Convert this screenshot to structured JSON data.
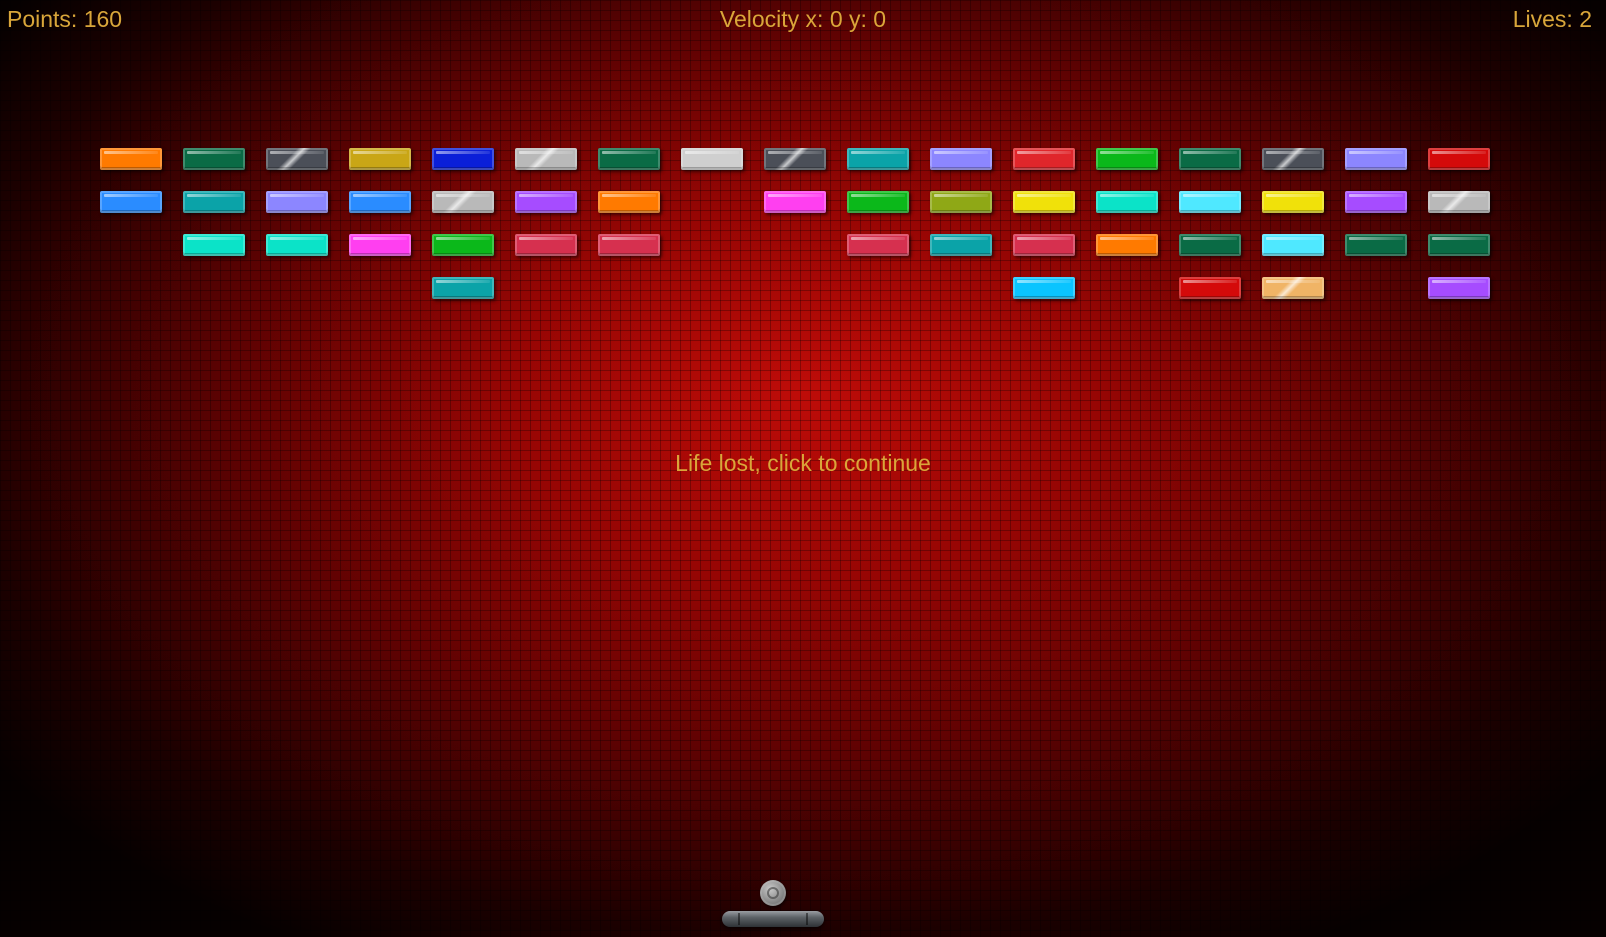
{
  "hud": {
    "points": "Points: 160",
    "velocity": "Velocity x: 0 y: 0",
    "lives": "Lives: 2"
  },
  "message": "Life lost, click to continue",
  "colors": {
    "hud_text": "#d9a63a"
  },
  "bricks": [
    [
      {
        "col": 0,
        "color": "#ff7a00"
      },
      {
        "col": 1,
        "color": "#0a6b45"
      },
      {
        "col": 2,
        "color": "#4b4f58",
        "shiny": true
      },
      {
        "col": 3,
        "color": "#c9a616"
      },
      {
        "col": 4,
        "color": "#0b1fd8"
      },
      {
        "col": 5,
        "color": "#b9b9b9",
        "shiny": true
      },
      {
        "col": 6,
        "color": "#0a6b45"
      },
      {
        "col": 7,
        "color": "#cfcfcf"
      },
      {
        "col": 8,
        "color": "#4b4f58",
        "shiny": true
      },
      {
        "col": 9,
        "color": "#0ba3a8"
      },
      {
        "col": 10,
        "color": "#8c86ff"
      },
      {
        "col": 11,
        "color": "#e0262b"
      },
      {
        "col": 12,
        "color": "#0bb81a"
      },
      {
        "col": 13,
        "color": "#0a6b45"
      },
      {
        "col": 14,
        "color": "#4b4f58",
        "shiny": true
      },
      {
        "col": 15,
        "color": "#8c86ff"
      },
      {
        "col": 16,
        "color": "#d40a0a"
      }
    ],
    [
      {
        "col": 0,
        "color": "#2a8cff"
      },
      {
        "col": 1,
        "color": "#0ba3a8"
      },
      {
        "col": 2,
        "color": "#8c86ff"
      },
      {
        "col": 3,
        "color": "#2a8cff"
      },
      {
        "col": 4,
        "color": "#b9b9b9",
        "shiny": true
      },
      {
        "col": 5,
        "color": "#a64cff"
      },
      {
        "col": 6,
        "color": "#ff7a00"
      },
      {
        "col": 8,
        "color": "#ff3ff0"
      },
      {
        "col": 9,
        "color": "#0bb81a"
      },
      {
        "col": 10,
        "color": "#8fa816"
      },
      {
        "col": 11,
        "color": "#f0e10a"
      },
      {
        "col": 12,
        "color": "#0be3c8"
      },
      {
        "col": 13,
        "color": "#4fe8ff"
      },
      {
        "col": 14,
        "color": "#f0e10a"
      },
      {
        "col": 15,
        "color": "#a64cff"
      },
      {
        "col": 16,
        "color": "#b9b9b9",
        "shiny": true
      }
    ],
    [
      {
        "col": 1,
        "color": "#0be3c8"
      },
      {
        "col": 2,
        "color": "#0be3c8"
      },
      {
        "col": 3,
        "color": "#ff3ff0"
      },
      {
        "col": 4,
        "color": "#0bb81a"
      },
      {
        "col": 5,
        "color": "#d6304f"
      },
      {
        "col": 6,
        "color": "#d6304f"
      },
      {
        "col": 9,
        "color": "#d6304f"
      },
      {
        "col": 10,
        "color": "#0ba3a8"
      },
      {
        "col": 11,
        "color": "#d6304f"
      },
      {
        "col": 12,
        "color": "#ff7a00"
      },
      {
        "col": 13,
        "color": "#0a6b45"
      },
      {
        "col": 14,
        "color": "#4fe8ff"
      },
      {
        "col": 15,
        "color": "#0a6b45"
      },
      {
        "col": 16,
        "color": "#0a6b45"
      }
    ],
    [
      {
        "col": 4,
        "color": "#0ba3a8"
      },
      {
        "col": 11,
        "color": "#0ac4ff"
      },
      {
        "col": 13,
        "color": "#d40a0a"
      },
      {
        "col": 14,
        "color": "#f0b466",
        "shiny": true
      },
      {
        "col": 16,
        "color": "#a64cff"
      }
    ]
  ]
}
